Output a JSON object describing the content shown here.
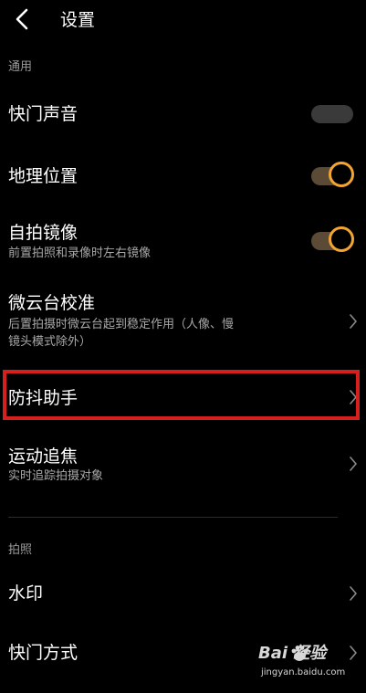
{
  "header": {
    "title": "设置"
  },
  "sections": {
    "general": "通用",
    "photo": "拍照"
  },
  "rows": {
    "shutter_sound": {
      "title": "快门声音",
      "toggle": "off"
    },
    "location": {
      "title": "地理位置",
      "toggle": "on"
    },
    "selfie_mirror": {
      "title": "自拍镜像",
      "subtitle": "前置拍照和录像时左右镜像",
      "toggle": "on"
    },
    "gimbal_calibration": {
      "title": "微云台校准",
      "subtitle": "后置拍摄时微云台起到稳定作用（人像、慢镜头模式除外）"
    },
    "stabilizer_assistant": {
      "title": "防抖助手"
    },
    "motion_tracking": {
      "title": "运动追焦",
      "subtitle": "实时追踪拍摄对象"
    },
    "watermark": {
      "title": "水印"
    },
    "shutter_mode": {
      "title": "快门方式"
    }
  },
  "watermark_overlay": {
    "logo_text": "Bai  经验",
    "url": "jingyan.baidu.com"
  },
  "colors": {
    "background": "#000000",
    "accent_toggle": "#f2a530",
    "highlight_box": "#d6201e",
    "secondary_text": "#a8a8a8"
  },
  "icons": {
    "back": "chevron-left-icon",
    "row_arrow": "chevron-right-icon",
    "watermark": "baidu-paw-icon"
  }
}
